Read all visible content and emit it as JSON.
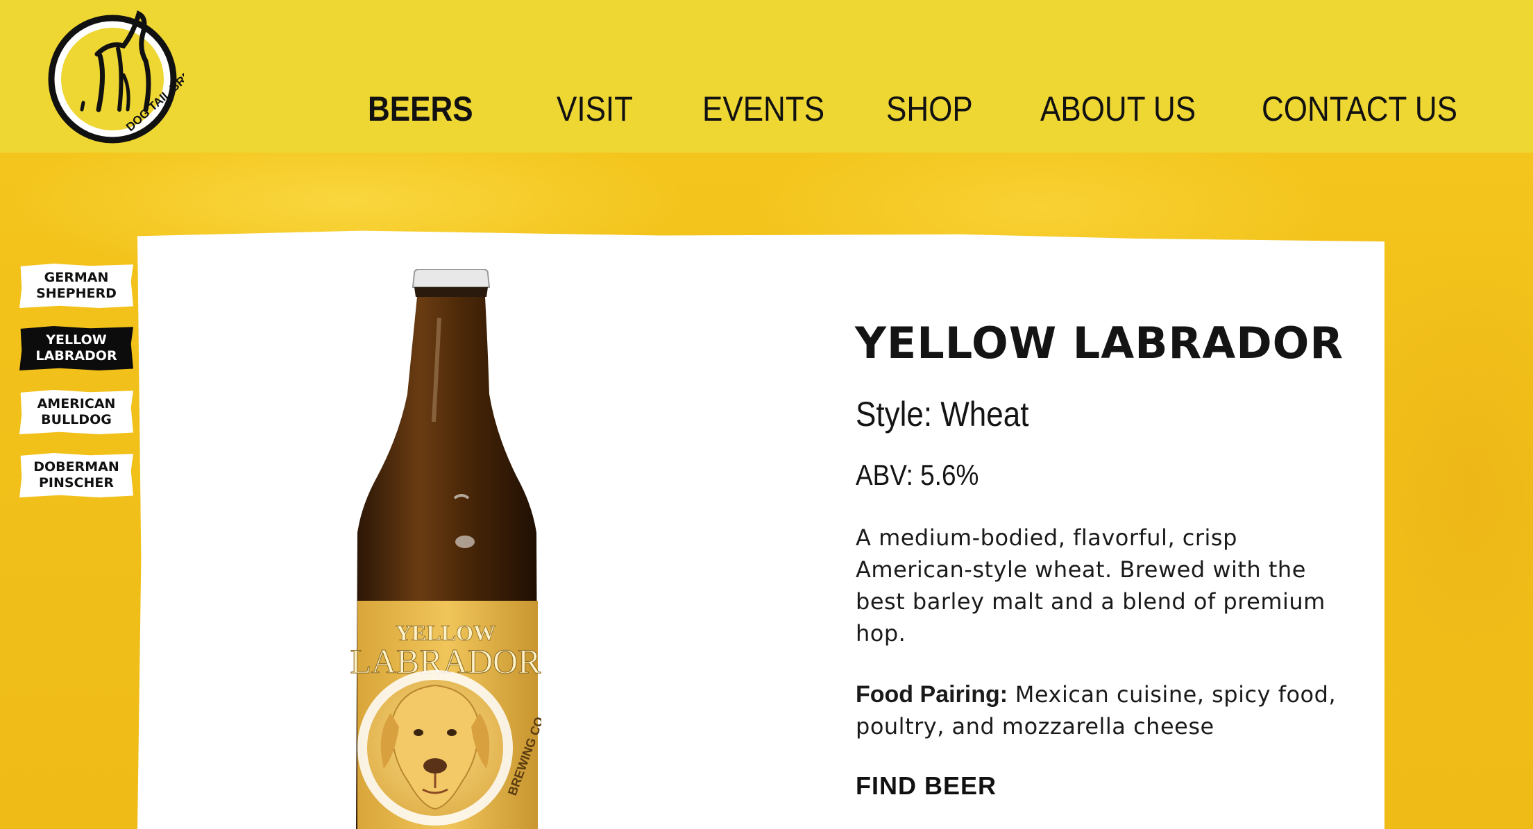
{
  "brand": {
    "logo_text": "DOG TAIL BREWING CO."
  },
  "nav": {
    "items": [
      {
        "label": "BEERS",
        "active": true
      },
      {
        "label": "VISIT",
        "active": false
      },
      {
        "label": "EVENTS",
        "active": false
      },
      {
        "label": "SHOP",
        "active": false
      },
      {
        "label": "ABOUT US",
        "active": false
      },
      {
        "label": "CONTACT US",
        "active": false
      }
    ]
  },
  "beer_tabs": [
    {
      "line1": "GERMAN",
      "line2": "SHEPHERD",
      "active": false
    },
    {
      "line1": "YELLOW",
      "line2": "LABRADOR",
      "active": true
    },
    {
      "line1": "AMERICAN",
      "line2": "BULLDOG",
      "active": false
    },
    {
      "line1": "DOBERMAN",
      "line2": "PINSCHER",
      "active": false
    }
  ],
  "beer": {
    "name": "YELLOW LABRADOR",
    "style": "Style: Wheat",
    "abv": "ABV: 5.6%",
    "description": "A medium-bodied, flavorful, crisp American-style wheat. Brewed with the best barley malt and a blend of premium hop.",
    "food_pairing_label": "Food Pairing:",
    "food_pairing": " Mexican cuisine, spicy food, poultry, and mozzarella cheese",
    "find_beer_label": "FIND BEER",
    "bottle_label_line1": "YELLOW",
    "bottle_label_line2": "LABRADOR",
    "bottle_label_brand": "BREWING CO."
  },
  "colors": {
    "header_bg": "#eed633",
    "page_bg": "#f2c21c",
    "text": "#111111",
    "active_tab_bg": "#0c0c0c"
  }
}
